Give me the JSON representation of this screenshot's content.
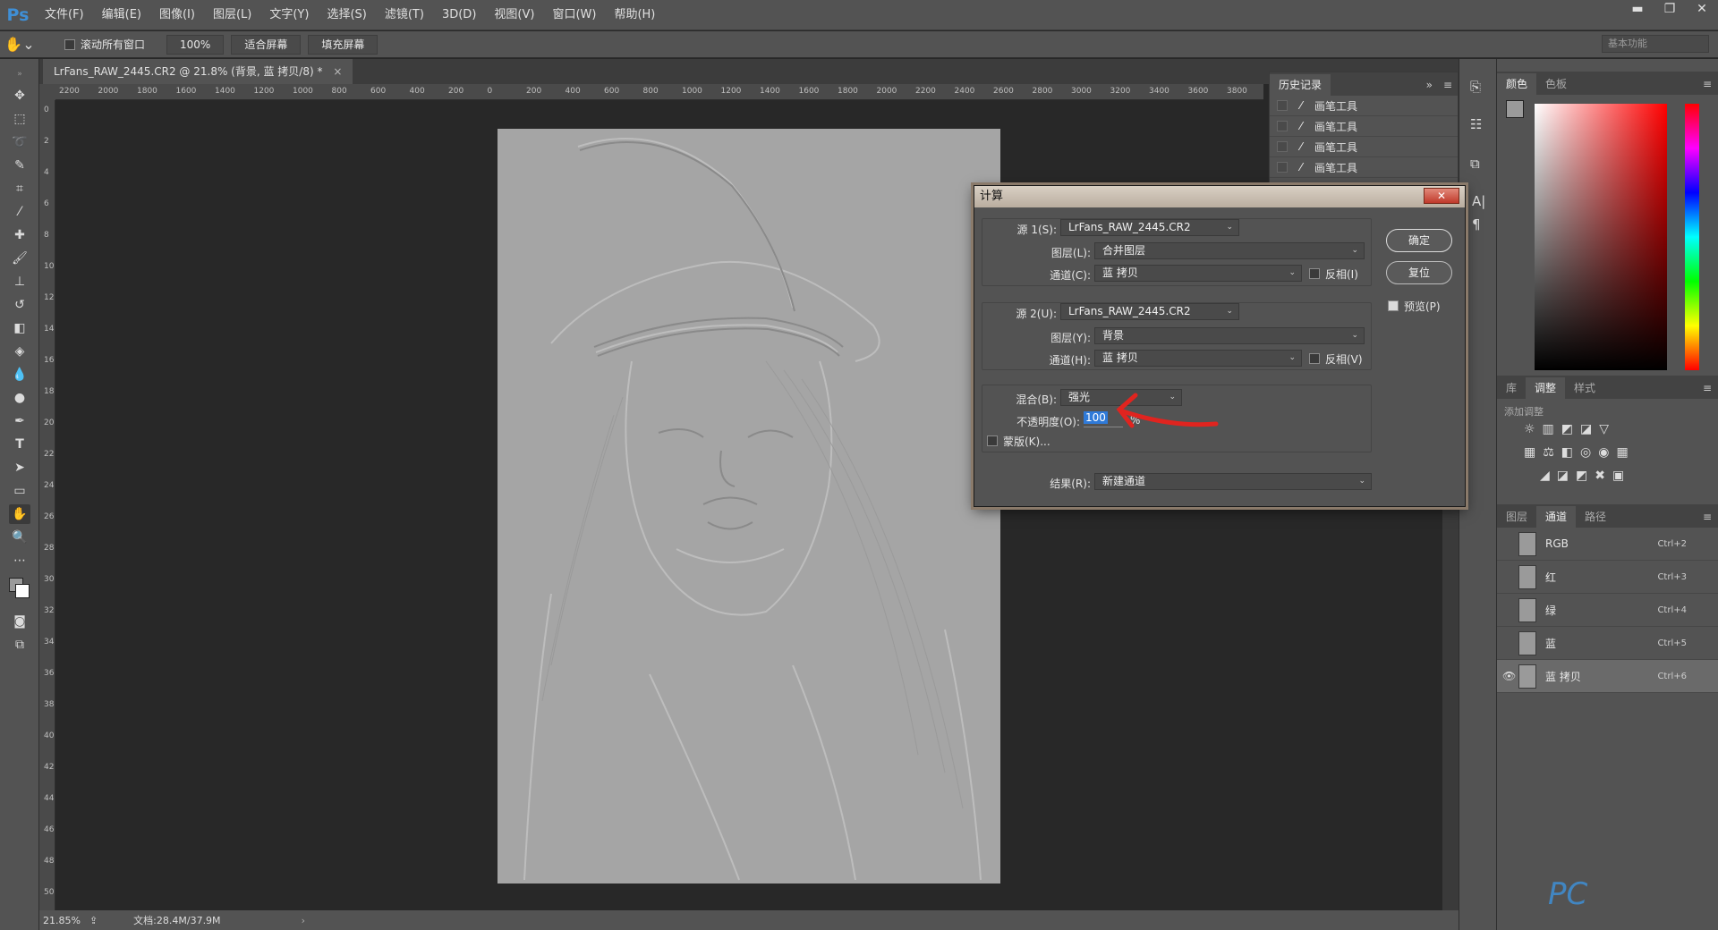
{
  "app": {
    "logo": "Ps"
  },
  "menu": [
    "文件(F)",
    "编辑(E)",
    "图像(I)",
    "图层(L)",
    "文字(Y)",
    "选择(S)",
    "滤镜(T)",
    "3D(D)",
    "视图(V)",
    "窗口(W)",
    "帮助(H)"
  ],
  "window_controls": {
    "minimize": "▬",
    "restore": "❐",
    "close": "✕"
  },
  "options": {
    "scroll_all_label": "滚动所有窗口",
    "zoom_btn": "100%",
    "fit_btn": "适合屏幕",
    "fill_btn": "填充屏幕",
    "workspace": "基本功能"
  },
  "document": {
    "tab_title": "LrFans_RAW_2445.CR2 @ 21.8% (背景, 蓝 拷贝/8) *",
    "tab_close": "×",
    "zoom_status": "21.85%",
    "doc_status": "文档:28.4M/37.9M",
    "ruler_h": [
      "2200",
      "2000",
      "1800",
      "1600",
      "1400",
      "1200",
      "1000",
      "800",
      "600",
      "400",
      "200",
      "0",
      "200",
      "400",
      "600",
      "800",
      "1000",
      "1200",
      "1400",
      "1600",
      "1800",
      "2000",
      "2200",
      "2400",
      "2600",
      "2800",
      "3000",
      "3200",
      "3400",
      "3600",
      "3800"
    ],
    "ruler_v": [
      "0",
      "2",
      "4",
      "6",
      "8",
      "10",
      "12",
      "14",
      "16",
      "18",
      "20",
      "22",
      "24",
      "26",
      "28",
      "30",
      "32",
      "34",
      "36",
      "38",
      "40",
      "42",
      "44",
      "46",
      "48",
      "50"
    ]
  },
  "history": {
    "tab": "历史记录",
    "items": [
      "画笔工具",
      "画笔工具",
      "画笔工具",
      "画笔工具"
    ]
  },
  "color_panel": {
    "tab_color": "颜色",
    "tab_swatches": "色板"
  },
  "adjust_panel": {
    "tab_lib": "库",
    "tab_adj": "调整",
    "tab_style": "样式",
    "subtitle": "添加调整"
  },
  "channels_panel": {
    "tab_layers": "图层",
    "tab_channels": "通道",
    "tab_paths": "路径",
    "rows": [
      {
        "name": "RGB",
        "shortcut": "Ctrl+2",
        "visible": "",
        "selected": false
      },
      {
        "name": "红",
        "shortcut": "Ctrl+3",
        "visible": "",
        "selected": false
      },
      {
        "name": "绿",
        "shortcut": "Ctrl+4",
        "visible": "",
        "selected": false
      },
      {
        "name": "蓝",
        "shortcut": "Ctrl+5",
        "visible": "",
        "selected": false
      },
      {
        "name": "蓝 拷贝",
        "shortcut": "Ctrl+6",
        "visible": "👁",
        "selected": true
      }
    ]
  },
  "dialog": {
    "title": "计算",
    "close": "✕",
    "ok": "确定",
    "reset": "复位",
    "preview_label": "预览(P)",
    "source1": {
      "label": "源 1(S):",
      "value": "LrFans_RAW_2445.CR2",
      "layer_label": "图层(L):",
      "layer": "合并图层",
      "channel_label": "通道(C):",
      "channel": "蓝 拷贝",
      "invert": "反相(I)"
    },
    "source2": {
      "label": "源 2(U):",
      "value": "LrFans_RAW_2445.CR2",
      "layer_label": "图层(Y):",
      "layer": "背景",
      "channel_label": "通道(H):",
      "channel": "蓝 拷贝",
      "invert": "反相(V)"
    },
    "blend": {
      "label": "混合(B):",
      "value": "强光",
      "opacity_label": "不透明度(O):",
      "opacity": "100",
      "percent": "%",
      "mask": "蒙版(K)..."
    },
    "result": {
      "label": "结果(R):",
      "value": "新建通道"
    }
  },
  "colors": {
    "accent": "#3f8fd6",
    "annotation": "#e0241f",
    "photo_gray": "#a3a3a3"
  }
}
